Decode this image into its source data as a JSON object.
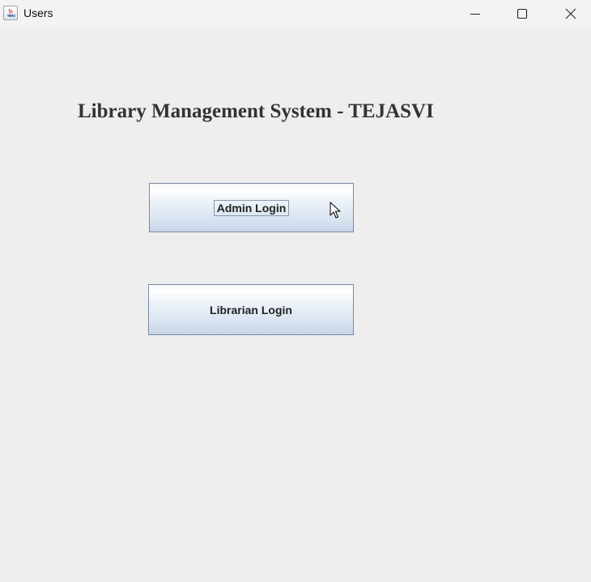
{
  "window": {
    "title": "Users",
    "controls": {
      "minimize": "minimize-icon",
      "maximize": "maximize-icon",
      "close": "close-icon"
    }
  },
  "main": {
    "heading": "Library Management System - TEJASVI",
    "buttons": {
      "admin_login": "Admin Login",
      "librarian_login": "Librarian Login"
    },
    "focused_button": "admin_login"
  },
  "colors": {
    "background": "#eeeeee",
    "heading_text": "#333333",
    "button_border": "#7a8aa3",
    "button_gradient_bottom": "#c7d5e8"
  }
}
